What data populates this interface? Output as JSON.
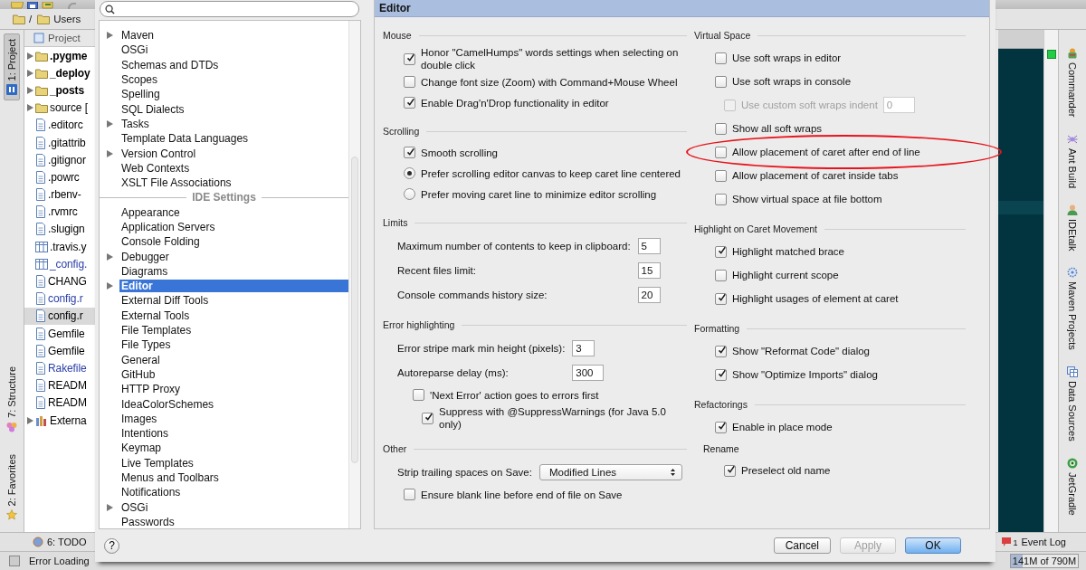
{
  "ide": {
    "breadcrumbs": [
      "/",
      "Users"
    ],
    "left_tabs": [
      {
        "label": "1: Project",
        "selected": true,
        "kind": "project"
      },
      {
        "label": "7: Structure",
        "selected": false,
        "kind": "structure"
      },
      {
        "label": "2: Favorites",
        "selected": false,
        "kind": "favorites"
      }
    ],
    "project": {
      "title": "Project",
      "items": [
        {
          "label": ".pygme",
          "kind": "folder",
          "expandable": true,
          "bold": true,
          "selected": false,
          "color": "#000000"
        },
        {
          "label": "_deploy",
          "kind": "folder",
          "expandable": true,
          "bold": true,
          "selected": false,
          "color": "#000000"
        },
        {
          "label": "_posts",
          "kind": "folder",
          "expandable": true,
          "bold": true,
          "selected": false,
          "color": "#000000"
        },
        {
          "label": "source [",
          "kind": "folder",
          "expandable": true,
          "bold": false,
          "selected": false,
          "color": "#000000"
        },
        {
          "label": ".editorc",
          "kind": "file",
          "expandable": false,
          "bold": false,
          "selected": false,
          "color": "#000000"
        },
        {
          "label": ".gitattrib",
          "kind": "file",
          "expandable": false,
          "bold": false,
          "selected": false,
          "color": "#000000"
        },
        {
          "label": ".gitignor",
          "kind": "file",
          "expandable": false,
          "bold": false,
          "selected": false,
          "color": "#000000"
        },
        {
          "label": ".powrc",
          "kind": "file",
          "expandable": false,
          "bold": false,
          "selected": false,
          "color": "#000000"
        },
        {
          "label": ".rbenv-",
          "kind": "file",
          "expandable": false,
          "bold": false,
          "selected": false,
          "color": "#000000"
        },
        {
          "label": ".rvmrc",
          "kind": "file",
          "expandable": false,
          "bold": false,
          "selected": false,
          "color": "#000000"
        },
        {
          "label": ".slugign",
          "kind": "file",
          "expandable": false,
          "bold": false,
          "selected": false,
          "color": "#000000"
        },
        {
          "label": ".travis.y",
          "kind": "table",
          "expandable": false,
          "bold": false,
          "selected": false,
          "color": "#000000"
        },
        {
          "label": "_config.",
          "kind": "table",
          "expandable": false,
          "bold": false,
          "selected": false,
          "color": "#2a3ea8"
        },
        {
          "label": "CHANG",
          "kind": "file",
          "expandable": false,
          "bold": false,
          "selected": false,
          "color": "#000000"
        },
        {
          "label": "config.r",
          "kind": "file",
          "expandable": false,
          "bold": false,
          "selected": false,
          "color": "#2a3ea8"
        },
        {
          "label": "config.r",
          "kind": "file",
          "expandable": false,
          "bold": false,
          "selected": true,
          "color": "#000000"
        },
        {
          "label": "Gemfile",
          "kind": "file",
          "expandable": false,
          "bold": false,
          "selected": false,
          "color": "#000000"
        },
        {
          "label": "Gemfile",
          "kind": "file",
          "expandable": false,
          "bold": false,
          "selected": false,
          "color": "#000000"
        },
        {
          "label": "Rakefile",
          "kind": "file",
          "expandable": false,
          "bold": false,
          "selected": false,
          "color": "#2a3ea8"
        },
        {
          "label": "READM",
          "kind": "file",
          "expandable": false,
          "bold": false,
          "selected": false,
          "color": "#000000"
        },
        {
          "label": "READM",
          "kind": "file",
          "expandable": false,
          "bold": false,
          "selected": false,
          "color": "#000000"
        },
        {
          "label": "Externa",
          "kind": "library",
          "expandable": true,
          "bold": false,
          "selected": false,
          "color": "#000000"
        }
      ]
    },
    "right_tabs": [
      {
        "label": "Commander",
        "kind": "commander"
      },
      {
        "label": "Ant Build",
        "kind": "ant"
      },
      {
        "label": "IDEtalk",
        "kind": "person"
      },
      {
        "label": "Maven Projects",
        "kind": "maven"
      },
      {
        "label": "Data Sources",
        "kind": "database"
      },
      {
        "label": "JetGradle",
        "kind": "gradle"
      }
    ],
    "todo_tab": "6: TODO",
    "event_log": {
      "label": "Event Log",
      "count": "1"
    },
    "status": "Error Loading",
    "memory": {
      "label": "141M of 790M",
      "level": 0.18
    }
  },
  "dialog": {
    "settings_tree": [
      {
        "kind": "item",
        "label": "Maven",
        "expandable": true,
        "selected": false
      },
      {
        "kind": "item",
        "label": "OSGi",
        "expandable": false,
        "selected": false
      },
      {
        "kind": "item",
        "label": "Schemas and DTDs",
        "expandable": false,
        "selected": false
      },
      {
        "kind": "item",
        "label": "Scopes",
        "expandable": false,
        "selected": false
      },
      {
        "kind": "item",
        "label": "Spelling",
        "expandable": false,
        "selected": false
      },
      {
        "kind": "item",
        "label": "SQL Dialects",
        "expandable": false,
        "selected": false
      },
      {
        "kind": "item",
        "label": "Tasks",
        "expandable": true,
        "selected": false
      },
      {
        "kind": "item",
        "label": "Template Data Languages",
        "expandable": false,
        "selected": false
      },
      {
        "kind": "item",
        "label": "Version Control",
        "expandable": true,
        "selected": false
      },
      {
        "kind": "item",
        "label": "Web Contexts",
        "expandable": false,
        "selected": false
      },
      {
        "kind": "item",
        "label": "XSLT File Associations",
        "expandable": false,
        "selected": false
      },
      {
        "kind": "header",
        "label": "IDE Settings"
      },
      {
        "kind": "item",
        "label": "Appearance",
        "expandable": false,
        "selected": false
      },
      {
        "kind": "item",
        "label": "Application Servers",
        "expandable": false,
        "selected": false
      },
      {
        "kind": "item",
        "label": "Console Folding",
        "expandable": false,
        "selected": false
      },
      {
        "kind": "item",
        "label": "Debugger",
        "expandable": true,
        "selected": false
      },
      {
        "kind": "item",
        "label": "Diagrams",
        "expandable": false,
        "selected": false
      },
      {
        "kind": "item",
        "label": "Editor",
        "expandable": true,
        "selected": true
      },
      {
        "kind": "item",
        "label": "External Diff Tools",
        "expandable": false,
        "selected": false
      },
      {
        "kind": "item",
        "label": "External Tools",
        "expandable": false,
        "selected": false
      },
      {
        "kind": "item",
        "label": "File Templates",
        "expandable": false,
        "selected": false
      },
      {
        "kind": "item",
        "label": "File Types",
        "expandable": false,
        "selected": false
      },
      {
        "kind": "item",
        "label": "General",
        "expandable": false,
        "selected": false
      },
      {
        "kind": "item",
        "label": "GitHub",
        "expandable": false,
        "selected": false
      },
      {
        "kind": "item",
        "label": "HTTP Proxy",
        "expandable": false,
        "selected": false
      },
      {
        "kind": "item",
        "label": "IdeaColorSchemes",
        "expandable": false,
        "selected": false
      },
      {
        "kind": "item",
        "label": "Images",
        "expandable": false,
        "selected": false
      },
      {
        "kind": "item",
        "label": "Intentions",
        "expandable": false,
        "selected": false
      },
      {
        "kind": "item",
        "label": "Keymap",
        "expandable": false,
        "selected": false
      },
      {
        "kind": "item",
        "label": "Live Templates",
        "expandable": false,
        "selected": false
      },
      {
        "kind": "item",
        "label": "Menus and Toolbars",
        "expandable": false,
        "selected": false
      },
      {
        "kind": "item",
        "label": "Notifications",
        "expandable": false,
        "selected": false
      },
      {
        "kind": "item",
        "label": "OSGi",
        "expandable": true,
        "selected": false
      },
      {
        "kind": "item",
        "label": "Passwords",
        "expandable": false,
        "selected": false
      }
    ],
    "panel_title": "Editor",
    "left_sections": [
      {
        "title": "Mouse",
        "items": [
          {
            "kind": "checkbox",
            "label": "Honor \"CamelHumps\" words settings when selecting on double click",
            "checked": true
          },
          {
            "kind": "checkbox",
            "label": "Change font size (Zoom) with Command+Mouse Wheel",
            "checked": false
          },
          {
            "kind": "checkbox",
            "label": "Enable Drag'n'Drop functionality in editor",
            "checked": true
          }
        ]
      },
      {
        "title": "Scrolling",
        "items": [
          {
            "kind": "checkbox",
            "label": "Smooth scrolling",
            "checked": true
          },
          {
            "kind": "radio",
            "label": "Prefer scrolling editor canvas to keep caret line centered",
            "selected": true
          },
          {
            "kind": "radio",
            "label": "Prefer moving caret line to minimize editor scrolling",
            "selected": false
          }
        ]
      },
      {
        "title": "Limits",
        "items": [
          {
            "kind": "number",
            "label": "Maximum number of contents to keep in clipboard:",
            "value": "5"
          },
          {
            "kind": "number",
            "label": "Recent files limit:",
            "value": "15"
          },
          {
            "kind": "number",
            "label": "Console commands history size:",
            "value": "20"
          }
        ]
      },
      {
        "title": "Error highlighting",
        "items": [
          {
            "kind": "number",
            "label": "Error stripe mark min height (pixels):",
            "value": "3"
          },
          {
            "kind": "number",
            "label": "Autoreparse delay (ms):",
            "value": "300",
            "children": [
              {
                "kind": "checkbox",
                "label": "'Next Error' action goes to errors first",
                "checked": false,
                "children": [
                  {
                    "kind": "checkbox",
                    "label": "Suppress with @SuppressWarnings (for Java 5.0 only)",
                    "checked": true
                  }
                ]
              }
            ]
          }
        ]
      },
      {
        "title": "Other",
        "items": [
          {
            "kind": "dropdown",
            "label": "Strip trailing spaces on Save:",
            "value": "Modified Lines"
          },
          {
            "kind": "checkbox",
            "label": "Ensure blank line before end of file on Save",
            "checked": false
          }
        ]
      }
    ],
    "right_sections": [
      {
        "title": "Virtual Space",
        "items": [
          {
            "kind": "checkbox",
            "label": "Use soft wraps in editor",
            "checked": false,
            "circled": false
          },
          {
            "kind": "checkbox",
            "label": "Use soft wraps in console",
            "checked": false,
            "circled": false,
            "children": [
              {
                "kind": "checkbox_field",
                "label": "Use custom soft wraps indent",
                "checked": false,
                "disabled": true,
                "value": "0"
              }
            ]
          },
          {
            "kind": "checkbox",
            "label": "Show all soft wraps",
            "checked": false,
            "circled": false
          },
          {
            "kind": "checkbox",
            "label": "Allow placement of caret after end of line",
            "checked": false,
            "circled": true
          },
          {
            "kind": "checkbox",
            "label": "Allow placement of caret inside tabs",
            "checked": false,
            "circled": false
          },
          {
            "kind": "checkbox",
            "label": "Show virtual space at file bottom",
            "checked": false,
            "circled": false
          }
        ]
      },
      {
        "title": "Highlight on Caret Movement",
        "items": [
          {
            "kind": "checkbox",
            "label": "Highlight matched brace",
            "checked": true
          },
          {
            "kind": "checkbox",
            "label": "Highlight current scope",
            "checked": false
          },
          {
            "kind": "checkbox",
            "label": "Highlight usages of element at caret",
            "checked": true
          }
        ]
      },
      {
        "title": "Formatting",
        "items": [
          {
            "kind": "checkbox",
            "label": "Show \"Reformat Code\" dialog",
            "checked": true
          },
          {
            "kind": "checkbox",
            "label": "Show \"Optimize Imports\" dialog",
            "checked": true
          }
        ]
      },
      {
        "title": "Refactorings",
        "items": [
          {
            "kind": "checkbox",
            "label": "Enable in place mode",
            "checked": true
          },
          {
            "kind": "subheading",
            "label": "Rename",
            "children": [
              {
                "kind": "checkbox",
                "label": "Preselect old name",
                "checked": true
              }
            ]
          }
        ]
      }
    ],
    "help_label": "?",
    "buttons": [
      {
        "label": "Cancel",
        "disabled": false,
        "default": false
      },
      {
        "label": "Apply",
        "disabled": true,
        "default": false
      },
      {
        "label": "OK",
        "disabled": false,
        "default": true
      }
    ]
  }
}
